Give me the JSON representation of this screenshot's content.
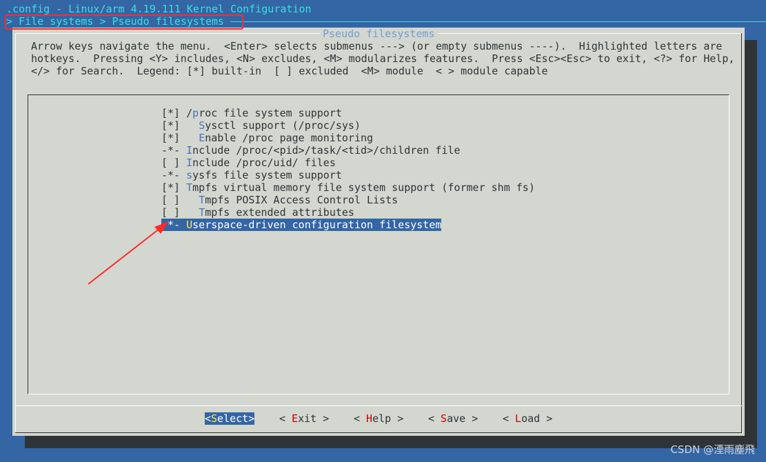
{
  "title": ".config - Linux/arm 4.19.111 Kernel Configuration",
  "breadcrumb": "> File systems > Pseudo filesystems",
  "dialog": {
    "title": "Pseudo filesystems",
    "help": [
      "Arrow keys navigate the menu.  <Enter> selects submenus ---> (or empty submenus ----).  Highlighted letters are",
      "hotkeys.  Pressing <Y> includes, <N> excludes, <M> modularizes features.  Press <Esc><Esc> to exit, <?> for Help,",
      "</> for Search.  Legend: [*] built-in  [ ] excluded  <M> module  < > module capable"
    ]
  },
  "items": [
    {
      "mark": "[*]",
      "indent": "",
      "hotkey": "/",
      "hk_index": 1,
      "label": "/proc file system support",
      "selected": false
    },
    {
      "mark": "[*]",
      "indent": "  ",
      "hk_index": 0,
      "label": "Sysctl support (/proc/sys)",
      "selected": false
    },
    {
      "mark": "[*]",
      "indent": "  ",
      "hk_index": 0,
      "label": "Enable /proc page monitoring",
      "selected": false
    },
    {
      "mark": "-*-",
      "indent": "",
      "hk_index": 0,
      "label": "Include /proc/<pid>/task/<tid>/children file",
      "selected": false
    },
    {
      "mark": "[ ]",
      "indent": "",
      "hk_index": 0,
      "label": "Include /proc/uid/ files",
      "selected": false
    },
    {
      "mark": "-*-",
      "indent": "",
      "hk_index": 0,
      "label": "sysfs file system support",
      "selected": false
    },
    {
      "mark": "[*]",
      "indent": "",
      "hk_index": 0,
      "label": "Tmpfs virtual memory file system support (former shm fs)",
      "selected": false
    },
    {
      "mark": "[ ]",
      "indent": "  ",
      "hk_index": 0,
      "label": "Tmpfs POSIX Access Control Lists",
      "selected": false
    },
    {
      "mark": "[ ]",
      "indent": "  ",
      "hk_index": 0,
      "label": "Tmpfs extended attributes",
      "selected": false
    },
    {
      "mark": "-*-",
      "indent": "",
      "hk_index": 0,
      "label": "Userspace-driven configuration filesystem",
      "selected": true
    }
  ],
  "buttons": [
    {
      "label": "<Select>",
      "hk_index": 1,
      "selected": true
    },
    {
      "label": "< Exit >",
      "hk_index": 2,
      "selected": false
    },
    {
      "label": "< Help >",
      "hk_index": 2,
      "selected": false
    },
    {
      "label": "< Save >",
      "hk_index": 2,
      "selected": false
    },
    {
      "label": "< Load >",
      "hk_index": 2,
      "selected": false
    }
  ],
  "watermark": "CSDN @湮雨塵飛",
  "colors": {
    "background": "#3465a4",
    "dialog": "#d3d7cf",
    "accent_cyan": "#34e2e2",
    "hotkey_red": "#cc0000",
    "hotkey_selected": "#fce94f",
    "annotation": "#ff2a2a"
  }
}
